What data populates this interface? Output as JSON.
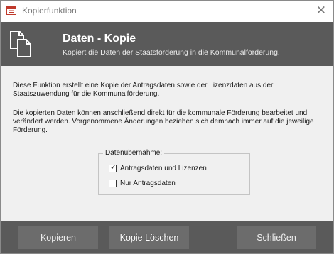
{
  "window": {
    "title": "Kopierfunktion",
    "close_glyph": "✕"
  },
  "header": {
    "title": "Daten - Kopie",
    "subtitle": "Kopiert die Daten der Staatsförderung in die Kommunalförderung."
  },
  "body": {
    "paragraph1": "Diese Funktion erstellt eine Kopie der Antragsdaten sowie der Lizenzdaten aus der Staatszuwendung für die Kommunalförderung.",
    "paragraph2": "Die kopierten Daten können anschließend direkt für die kommunale Förderung bearbeitet und verändert werden. Vorgenommene Änderungen beziehen sich demnach immer auf die jeweilige Förderung."
  },
  "group": {
    "legend": "Datenübernahme:",
    "options": [
      {
        "label": "Antragsdaten und Lizenzen",
        "checked": true
      },
      {
        "label": "Nur Antragsdaten",
        "checked": false
      }
    ]
  },
  "buttons": {
    "copy": "Kopieren",
    "delete_copy": "Kopie Löschen",
    "close": "Schließen"
  },
  "icons": {
    "app": "form-icon",
    "header": "copy-documents-icon"
  },
  "colors": {
    "header_bg": "#5a5a5a",
    "button_bg": "#6c6c6c",
    "body_bg": "#f0f0f0"
  }
}
